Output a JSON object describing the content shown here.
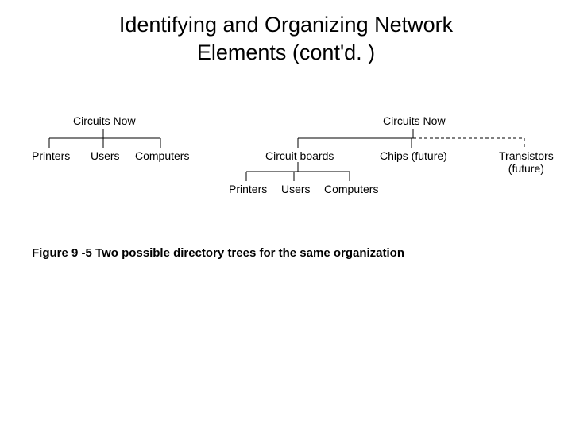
{
  "title_line1": "Identifying and Organizing Network",
  "title_line2": "Elements (cont'd. )",
  "caption": "Figure 9 -5 Two possible directory trees for the same organization",
  "left_tree": {
    "root": "Circuits Now",
    "children": [
      "Printers",
      "Users",
      "Computers"
    ]
  },
  "right_tree": {
    "root": "Circuits Now",
    "children": {
      "boards": {
        "label": "Circuit boards",
        "children": [
          "Printers",
          "Users",
          "Computers"
        ]
      },
      "chips": "Chips (future)",
      "transistors_line1": "Transistors",
      "transistors_line2": "(future)"
    }
  }
}
